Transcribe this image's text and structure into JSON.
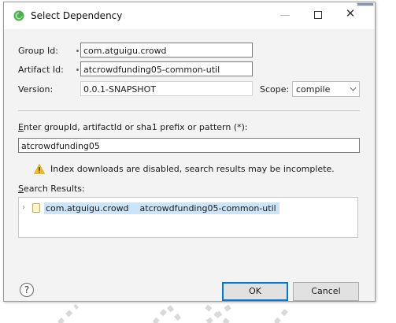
{
  "window": {
    "title": "Select Dependency",
    "close_glyph": "✕"
  },
  "form": {
    "group_id_label": "Group Id:",
    "group_id_value": "com.atguigu.crowd",
    "artifact_id_label": "Artifact Id:",
    "artifact_id_value": "atcrowdfunding05-common-util",
    "version_label": "Version:",
    "version_value": "0.0.1-SNAPSHOT",
    "scope_label": "Scope:",
    "scope_value": "compile"
  },
  "search": {
    "prompt_mnemonic": "E",
    "prompt_rest": "nter groupId, artifactId or sha1 prefix or pattern (*):",
    "query": "atcrowdfunding05",
    "warning": "Index downloads are disabled, search results may be incomplete.",
    "results_label_mnemonic": "S",
    "results_label_rest": "earch Results:",
    "results": [
      {
        "group": "com.atguigu.crowd",
        "artifact": "atcrowdfunding05-common-util"
      }
    ]
  },
  "footer": {
    "help_glyph": "?",
    "ok_label": "OK",
    "cancel_label": "Cancel"
  },
  "colors": {
    "selection": "#cce4f7",
    "default_button_border": "#0078d7",
    "warning_icon": "#f4c01b",
    "eclipse_icon": "#4caf50"
  }
}
